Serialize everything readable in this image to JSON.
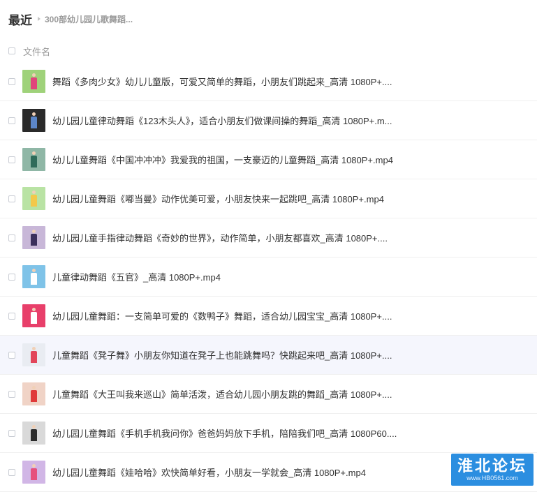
{
  "breadcrumb": {
    "root": "最近",
    "current": "300部幼儿园儿歌舞蹈..."
  },
  "list": {
    "header_label": "文件名"
  },
  "files": [
    {
      "name": "舞蹈《多肉少女》幼儿儿童版，可爱又简单的舞蹈，小朋友们跳起来_高清 1080P+....",
      "thumb_bg": "#9fd27a",
      "thumb_figure": "#e0457b"
    },
    {
      "name": "幼儿园儿童律动舞蹈《123木头人》，适合小朋友们做课间操的舞蹈_高清 1080P+.m...",
      "thumb_bg": "#2a2a2a",
      "thumb_figure": "#5c86c8"
    },
    {
      "name": "幼儿儿童舞蹈《中国冲冲冲》我爱我的祖国，一支豪迈的儿童舞蹈_高清 1080P+.mp4",
      "thumb_bg": "#8fb7a6",
      "thumb_figure": "#2f6b5a"
    },
    {
      "name": "幼儿园儿童舞蹈《嘟当曼》动作优美可爱，小朋友快来一起跳吧_高清 1080P+.mp4",
      "thumb_bg": "#b9e3a4",
      "thumb_figure": "#f3c84a"
    },
    {
      "name": "幼儿园儿童手指律动舞蹈《奇妙的世界》，动作简单，小朋友都喜欢_高清 1080P+....",
      "thumb_bg": "#c8b7d8",
      "thumb_figure": "#3b2f5c"
    },
    {
      "name": "儿童律动舞蹈《五官》_高清 1080P+.mp4",
      "thumb_bg": "#7fc3e8",
      "thumb_figure": "#ffffff"
    },
    {
      "name": "幼儿园儿童舞蹈：一支简单可爱的《数鸭子》舞蹈，适合幼儿园宝宝_高清 1080P+....",
      "thumb_bg": "#e83f6a",
      "thumb_figure": "#ffffff"
    },
    {
      "name": "儿童舞蹈《凳子舞》小朋友你知道在凳子上也能跳舞吗？快跳起来吧_高清 1080P+....",
      "thumb_bg": "#e9ecf2",
      "thumb_figure": "#e2455a"
    },
    {
      "name": "儿童舞蹈《大王叫我来巡山》简单活泼，适合幼儿园小朋友跳的舞蹈_高清 1080P+....",
      "thumb_bg": "#f0d3c6",
      "thumb_figure": "#e03a3a"
    },
    {
      "name": "幼儿园儿童舞蹈《手机手机我问你》爸爸妈妈放下手机，陪陪我们吧_高清 1080P60....",
      "thumb_bg": "#d9d9d9",
      "thumb_figure": "#2b2b2b"
    },
    {
      "name": "幼儿园儿童舞蹈《娃哈哈》欢快简单好看，小朋友一学就会_高清 1080P+.mp4",
      "thumb_bg": "#d1b6e6",
      "thumb_figure": "#e6507e"
    }
  ],
  "watermark": {
    "title": "淮北论坛",
    "url": "www.HB0561.com"
  },
  "colors": {
    "highlight_row": "#f5f6fd",
    "watermark_bg": "#2b8ee0"
  }
}
